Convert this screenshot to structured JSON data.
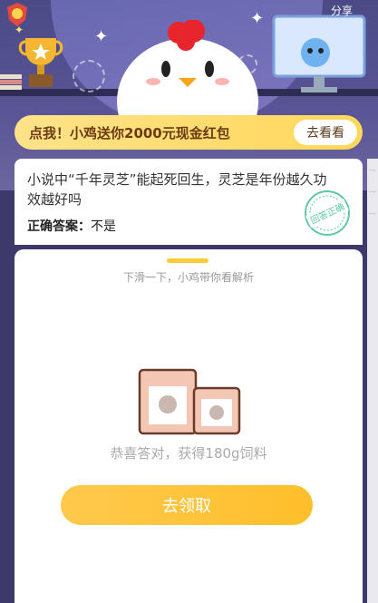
{
  "header": {
    "share_label": "分享"
  },
  "promo": {
    "text": "点我！小鸡送你2000元现金红包",
    "button_label": "去看看"
  },
  "question": {
    "text": "小说中“千年灵芝”能起死回生，灵芝是年份越久功效越好吗",
    "answer_label": "正确答案：",
    "answer_value": "不是",
    "stamp_text": "回答正确"
  },
  "panel": {
    "hint": "下滑一下，小鸡带你看解析",
    "reward_text": "恭喜答对，获得180g饲料",
    "claim_button": "去领取"
  },
  "colors": {
    "accent": "#ffc233",
    "stamp": "#5cc7a4"
  }
}
